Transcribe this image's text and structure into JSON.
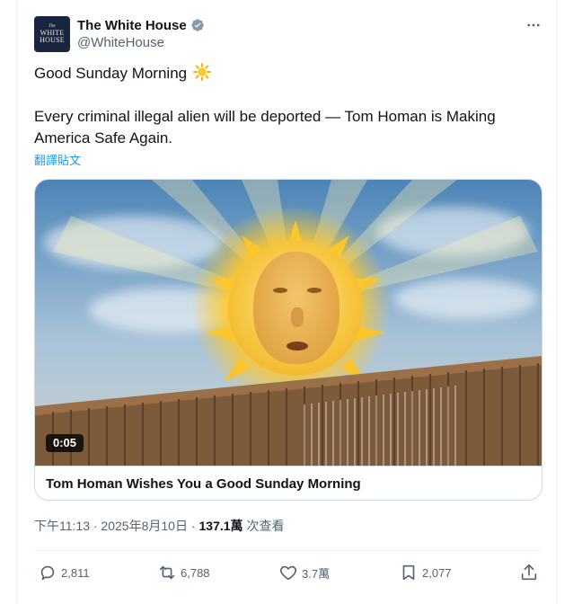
{
  "tweet": {
    "avatar_text": {
      "line1": "The",
      "line2": "WHITE",
      "line3": "HOUSE"
    },
    "display_name": "The White House",
    "handle": "@WhiteHouse",
    "text_line1": "Good Sunday Morning",
    "text_line2": "Every criminal illegal alien will be deported — Tom Homan is Making America Safe Again.",
    "translate_label": "翻譯貼文",
    "media": {
      "duration": "0:05",
      "caption": "Tom Homan Wishes You a Good Sunday Morning"
    },
    "meta": {
      "timestamp": "下午11:13 · 2025年8月10日 · ",
      "views_count": "137.1萬",
      "views_label": "次查看"
    },
    "actions": {
      "replies": "2,811",
      "reposts": "6,788",
      "likes": "3.7萬",
      "bookmarks": "2,077"
    }
  },
  "colors": {
    "accent": "#1d9bf0",
    "text_primary": "#0f1419",
    "text_secondary": "#536471",
    "border": "#cfd9de"
  },
  "icons": [
    "verified-badge-icon",
    "more-icon",
    "sun-emoji-icon",
    "reply-icon",
    "repost-icon",
    "like-icon",
    "bookmark-icon",
    "share-icon"
  ]
}
